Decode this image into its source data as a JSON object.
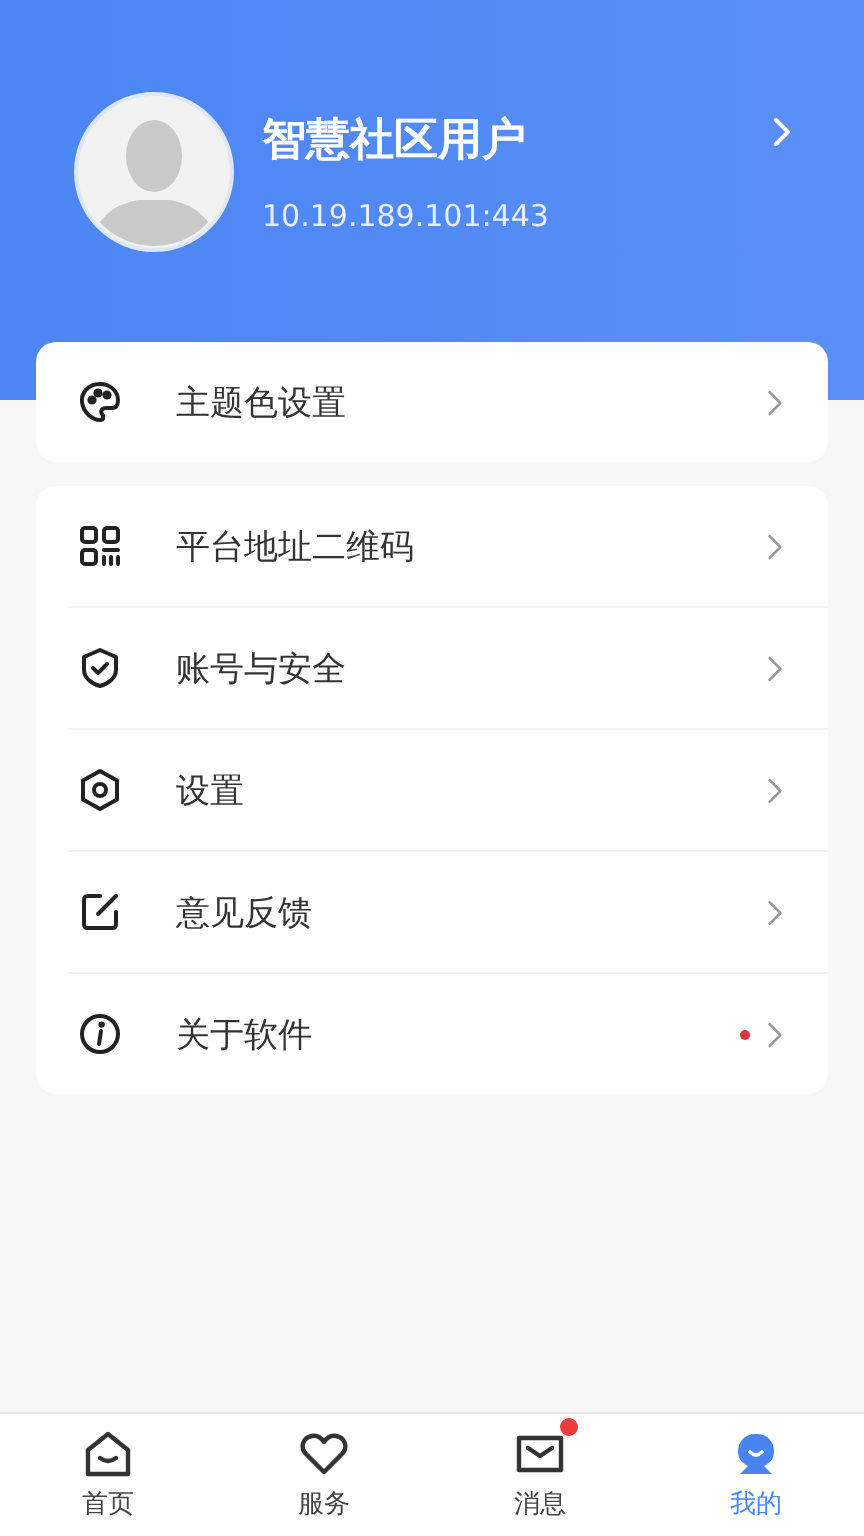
{
  "profile": {
    "name": "智慧社区用户",
    "address": "10.19.189.101:443"
  },
  "menu_groups": [
    {
      "items": [
        {
          "kind": "palette",
          "label": "主题色设置",
          "badge": false
        }
      ]
    },
    {
      "items": [
        {
          "kind": "qrcode",
          "label": "平台地址二维码",
          "badge": false
        },
        {
          "kind": "shield",
          "label": "账号与安全",
          "badge": false
        },
        {
          "kind": "gear",
          "label": "设置",
          "badge": false
        },
        {
          "kind": "edit",
          "label": "意见反馈",
          "badge": false
        },
        {
          "kind": "info",
          "label": "关于软件",
          "badge": true
        }
      ]
    }
  ],
  "tab_bar": [
    {
      "kind": "home",
      "label": "首页",
      "selected": false,
      "badge": false
    },
    {
      "kind": "heart",
      "label": "服务",
      "selected": false,
      "badge": false
    },
    {
      "kind": "mail",
      "label": "消息",
      "selected": false,
      "badge": true
    },
    {
      "kind": "me",
      "label": "我的",
      "selected": true,
      "badge": false
    }
  ]
}
